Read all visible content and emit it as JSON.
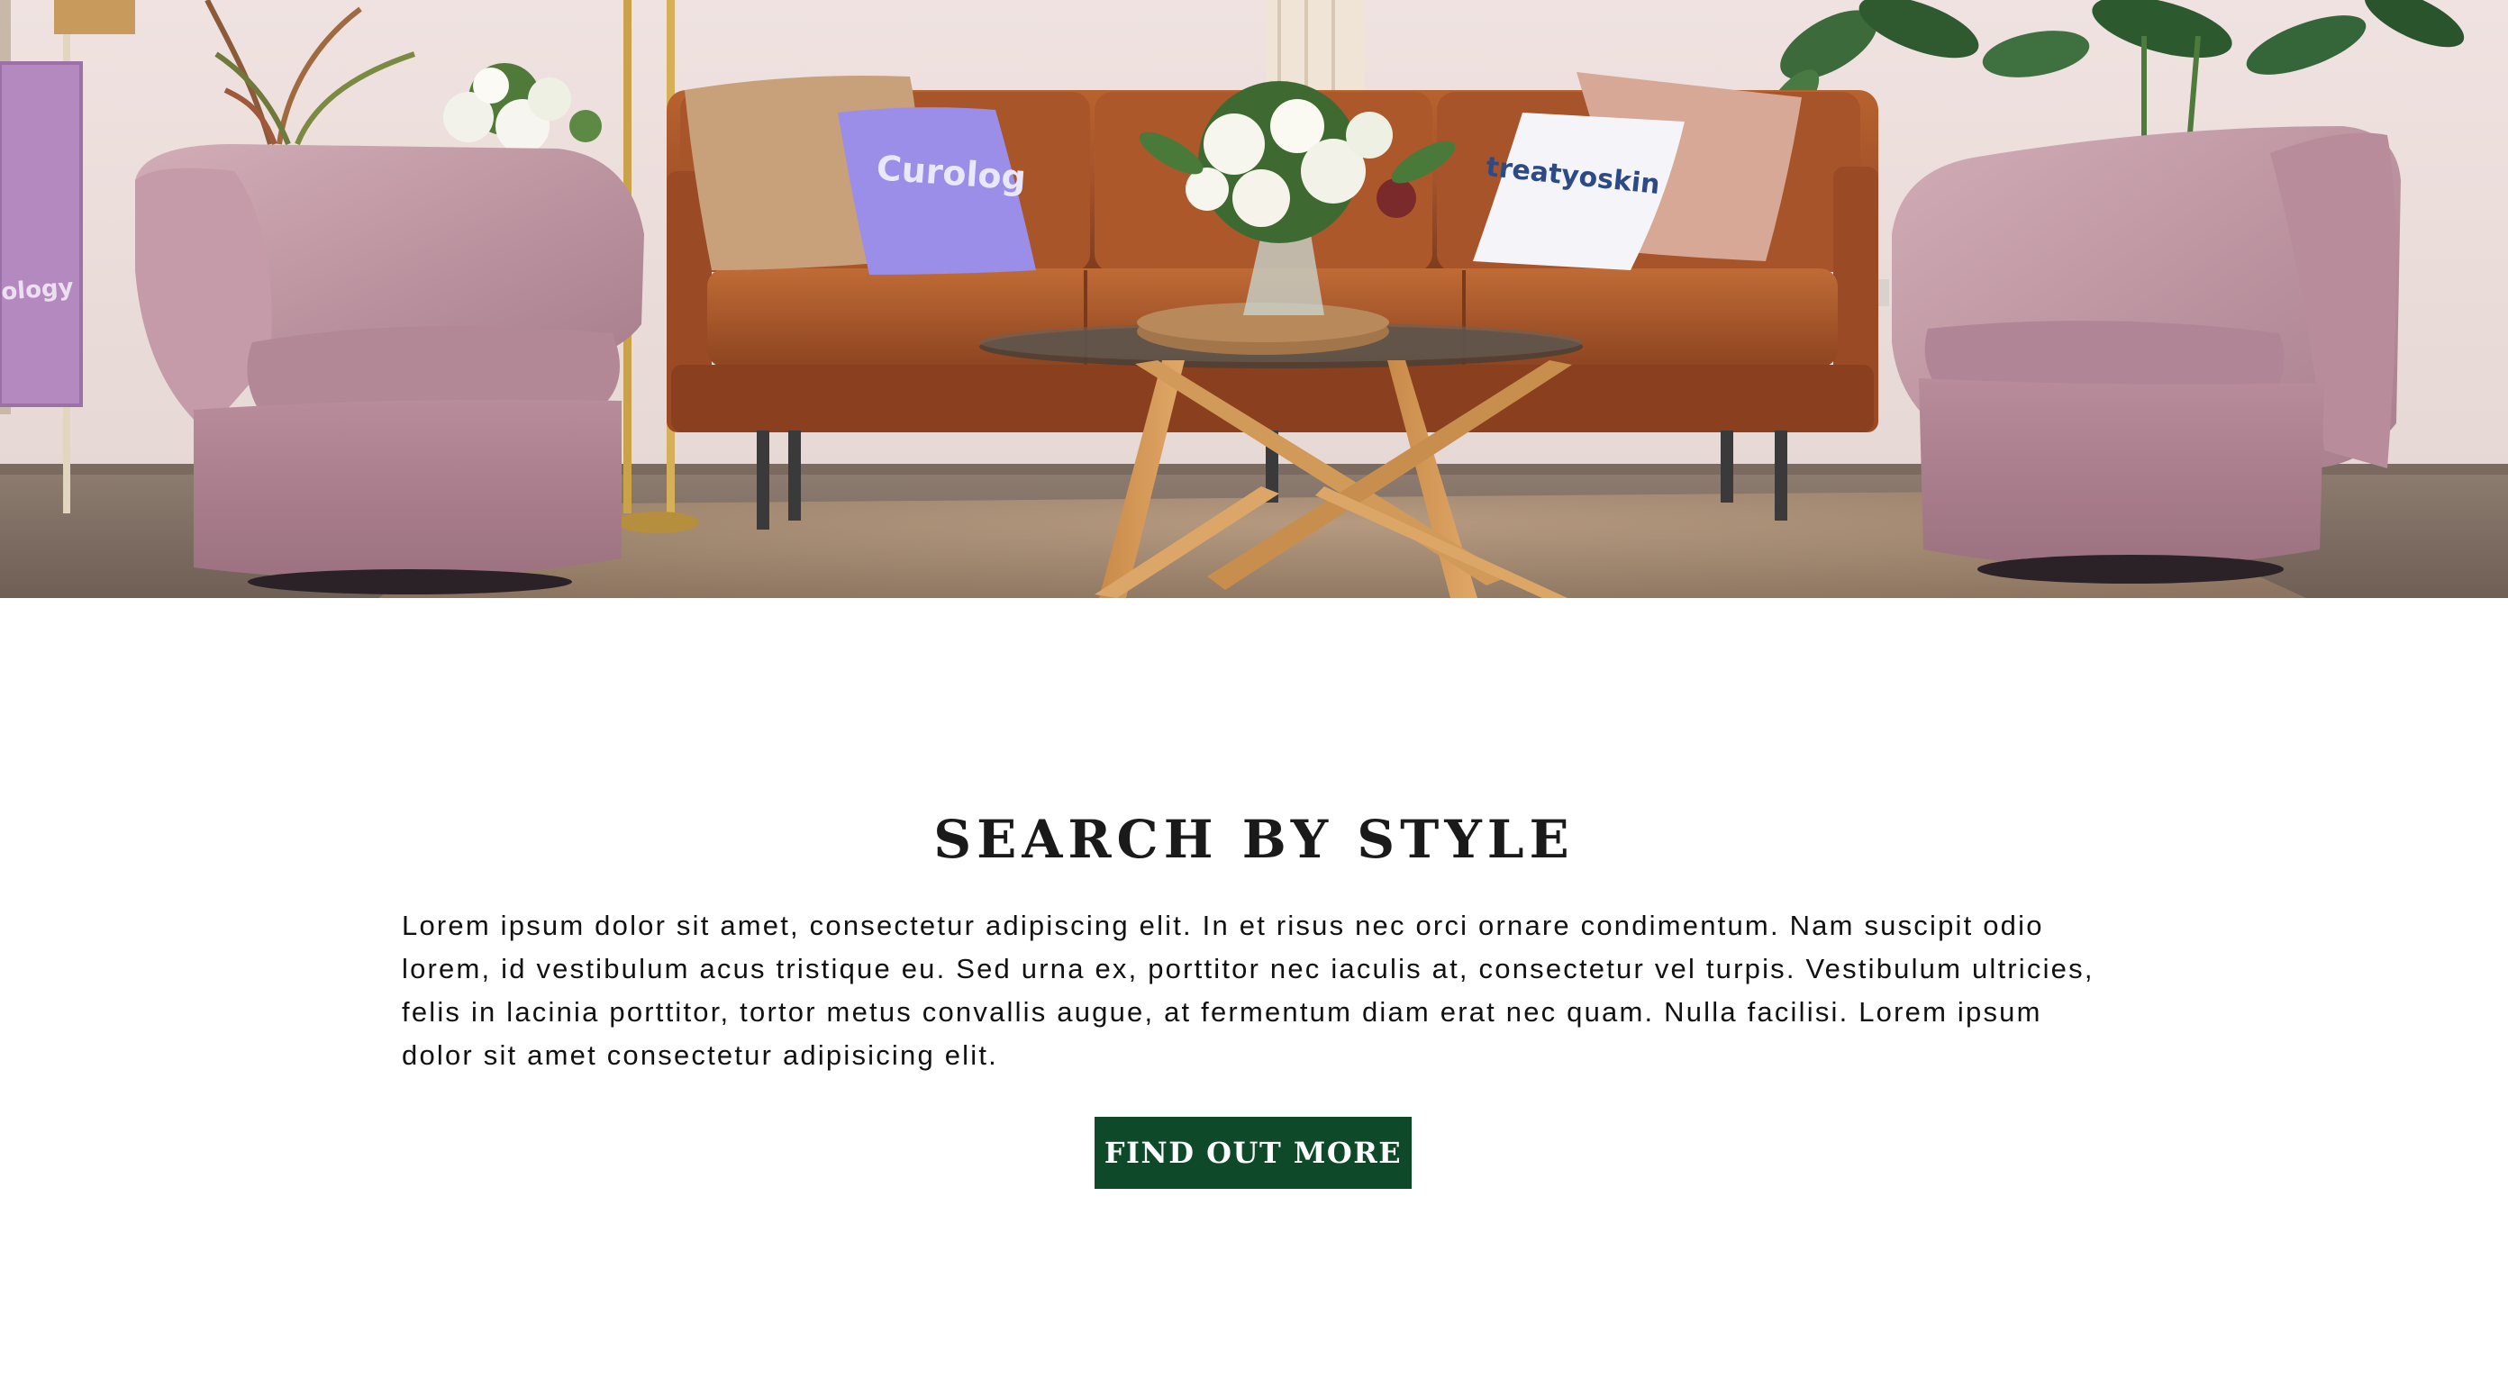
{
  "hero": {
    "pillow_left_text": "Curolog",
    "pillow_right_text": "treatyoskin",
    "throw_text": "ology"
  },
  "section": {
    "title": "SEARCH BY STYLE",
    "body": "Lorem ipsum dolor sit amet, consectetur adipiscing elit. In et risus nec orci ornare condimentum. Nam suscipit odio lorem, id vestibulum acus tristique eu. Sed urna ex, porttitor nec iaculis at, consectetur vel turpis. Vestibulum ultricies, felis in lacinia porttitor, tortor metus convallis augue, at fermentum diam erat nec quam. Nulla facilisi. Lorem ipsum dolor sit amet consectetur adipisicing elit.",
    "button_label": "FIND OUT MORE"
  },
  "colors": {
    "button_bg": "#0e4a2a",
    "title_text": "#1a1a1a",
    "body_text": "#111111",
    "sofa_leather": "#a8552a",
    "chair_pink": "#c49aa8",
    "wall": "#efe4e2"
  }
}
